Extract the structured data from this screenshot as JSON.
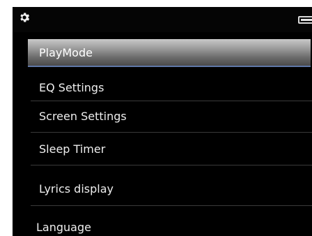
{
  "status_bar": {
    "left_icon": "gear-icon",
    "right_icon": "battery-icon"
  },
  "menu": {
    "selected_index": 0,
    "items": [
      {
        "label": "PlayMode"
      },
      {
        "label": "EQ Settings"
      },
      {
        "label": "Screen Settings"
      },
      {
        "label": "Sleep Timer"
      },
      {
        "label": "Lyrics display"
      },
      {
        "label": "Language"
      }
    ]
  },
  "colors": {
    "background": "#000000",
    "selection_highlight": "#9c9c9c",
    "selection_underline": "#5f78a8",
    "text": "#eeeeee"
  }
}
